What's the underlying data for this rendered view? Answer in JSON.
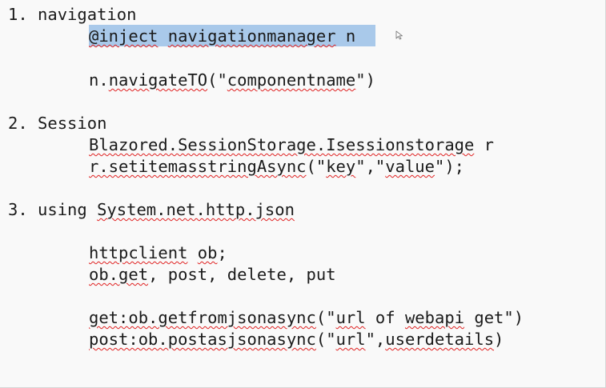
{
  "item1": {
    "heading": "1. navigation",
    "line1": {
      "at": "@inject",
      "space1": " ",
      "manager": "navigationmanager",
      "rest": " n"
    },
    "line2": {
      "start": "n.",
      "method": "navigateTO",
      "open": "(\"",
      "arg": "componentname",
      "close": "\")"
    }
  },
  "item2": {
    "heading": "2. Session",
    "line1": {
      "type": "Blazored.SessionStorage.Isessionstorage",
      "rest": " r"
    },
    "line2": {
      "obj": "r.setitemasstringAsync",
      "open": "(\"",
      "key": "key",
      "mid": "\",\"",
      "value": "value",
      "close": "\");"
    }
  },
  "item3": {
    "heading_prefix": "3. using ",
    "heading_ns": "System.net.http.json",
    "line1": {
      "type": "httpclient",
      "space": " ",
      "var": "ob",
      "end": ";"
    },
    "line2": {
      "method": "ob.get",
      "rest": ", post, delete, put"
    },
    "line3": {
      "label": "get:ob.getfromjsonasync",
      "open": "(\"",
      "url": "url",
      "sp": " of ",
      "api": "webapi",
      "tail": " get\")"
    },
    "line4": {
      "label": "post:ob.postasjsonasync",
      "open": "(\"",
      "url": "url",
      "mid": "\",",
      "arg": "userdetails",
      "close": ")"
    }
  }
}
